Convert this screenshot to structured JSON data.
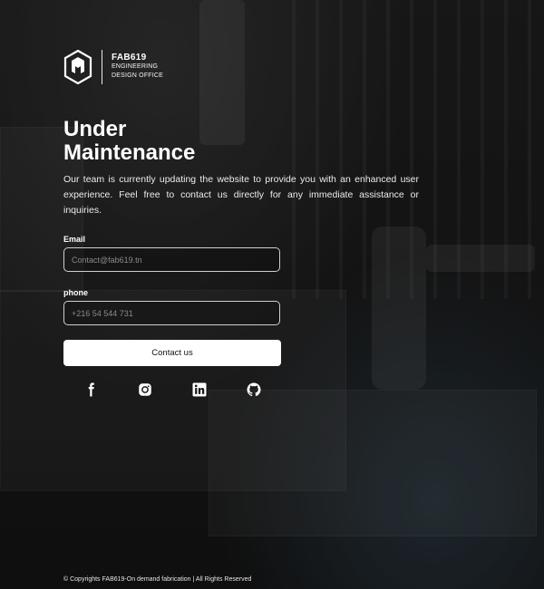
{
  "brand": {
    "name": "FAB619",
    "subtitle_line1": "ENGINEERING",
    "subtitle_line2": "DESIGN OFFICE"
  },
  "heading": {
    "line1": "Under",
    "line2": "Maintenance"
  },
  "description": "Our team is currently updating the website to provide you with an enhanced user experience. Feel free to contact us directly for any immediate assistance or inquiries.",
  "form": {
    "email_label": "Email",
    "email_placeholder": "Contact@fab619.tn",
    "phone_label": "phone",
    "phone_placeholder": "+216 54 544 731",
    "submit_label": "Contact us"
  },
  "socials": [
    {
      "icon": "facebook-icon"
    },
    {
      "icon": "instagram-icon"
    },
    {
      "icon": "linkedin-icon"
    },
    {
      "icon": "github-icon"
    }
  ],
  "footer": "© Copyrights FAB619-On demand fabrication | All Rights Reserved",
  "colors": {
    "button_bg": "#ffffff",
    "text": "#ffffff",
    "field_border": "#cfcfcf"
  }
}
